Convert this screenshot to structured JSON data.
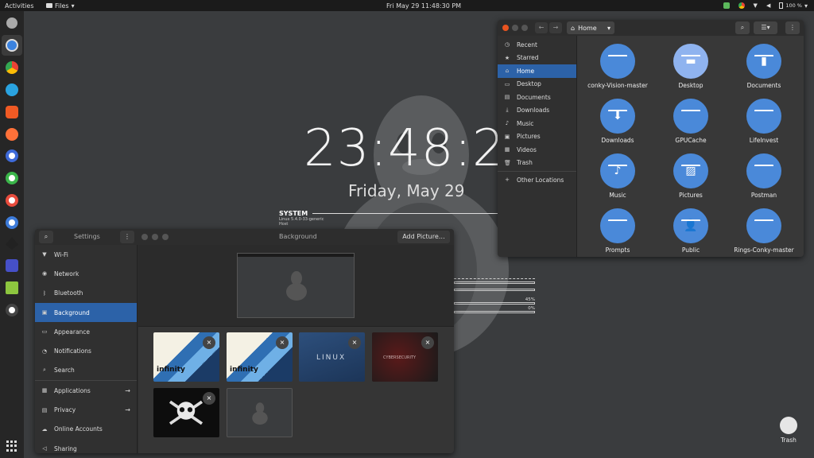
{
  "topbar": {
    "activities": "Activities",
    "app_menu": "Files",
    "clock": "Fri May 29  11:48:30 PM",
    "battery": "100 %"
  },
  "conky": {
    "time": "23:48:29",
    "date": "Friday, May 29",
    "system_heading": "SYSTEM",
    "kernel": "Linux 5.4.0-33-generic",
    "host": "Host",
    "pct_1": "45%",
    "pct_2": "0%"
  },
  "files_window": {
    "path": "Home",
    "sidebar": [
      {
        "icon": "clock-icon",
        "label": "Recent"
      },
      {
        "icon": "star-icon",
        "label": "Starred"
      },
      {
        "icon": "home-icon",
        "label": "Home"
      },
      {
        "icon": "desktop-icon",
        "label": "Desktop"
      },
      {
        "icon": "document-icon",
        "label": "Documents"
      },
      {
        "icon": "download-icon",
        "label": "Downloads"
      },
      {
        "icon": "music-icon",
        "label": "Music"
      },
      {
        "icon": "pictures-icon",
        "label": "Pictures"
      },
      {
        "icon": "video-icon",
        "label": "Videos"
      },
      {
        "icon": "trash-icon",
        "label": "Trash"
      },
      {
        "icon": "plus-icon",
        "label": "Other Locations"
      }
    ],
    "items": [
      "conky-Vision-master",
      "Desktop",
      "Documents",
      "Downloads",
      "GPUCache",
      "LifeInvest",
      "Music",
      "Pictures",
      "Postman",
      "Prompts",
      "Public",
      "Rings-Conky-master"
    ]
  },
  "settings_window": {
    "title": "Settings",
    "panel_title": "Background",
    "add_button": "Add Picture…",
    "sidebar": [
      {
        "icon": "wifi-icon",
        "label": "Wi-Fi"
      },
      {
        "icon": "network-icon",
        "label": "Network"
      },
      {
        "icon": "bluetooth-icon",
        "label": "Bluetooth"
      },
      {
        "icon": "background-icon",
        "label": "Background"
      },
      {
        "icon": "appearance-icon",
        "label": "Appearance"
      },
      {
        "icon": "bell-icon",
        "label": "Notifications"
      },
      {
        "icon": "search-icon",
        "label": "Search"
      },
      {
        "icon": "apps-icon",
        "label": "Applications"
      },
      {
        "icon": "lock-icon",
        "label": "Privacy"
      },
      {
        "icon": "cloud-icon",
        "label": "Online Accounts"
      },
      {
        "icon": "share-icon",
        "label": "Sharing"
      }
    ],
    "thumb_text": {
      "infinity": "infinity",
      "linux": "LINUX",
      "cyber": "CYBERSECURITY"
    }
  },
  "desktop": {
    "trash_label": "Trash"
  },
  "colors": {
    "accent": "#2c62a8",
    "folder": "#4a89d9"
  }
}
